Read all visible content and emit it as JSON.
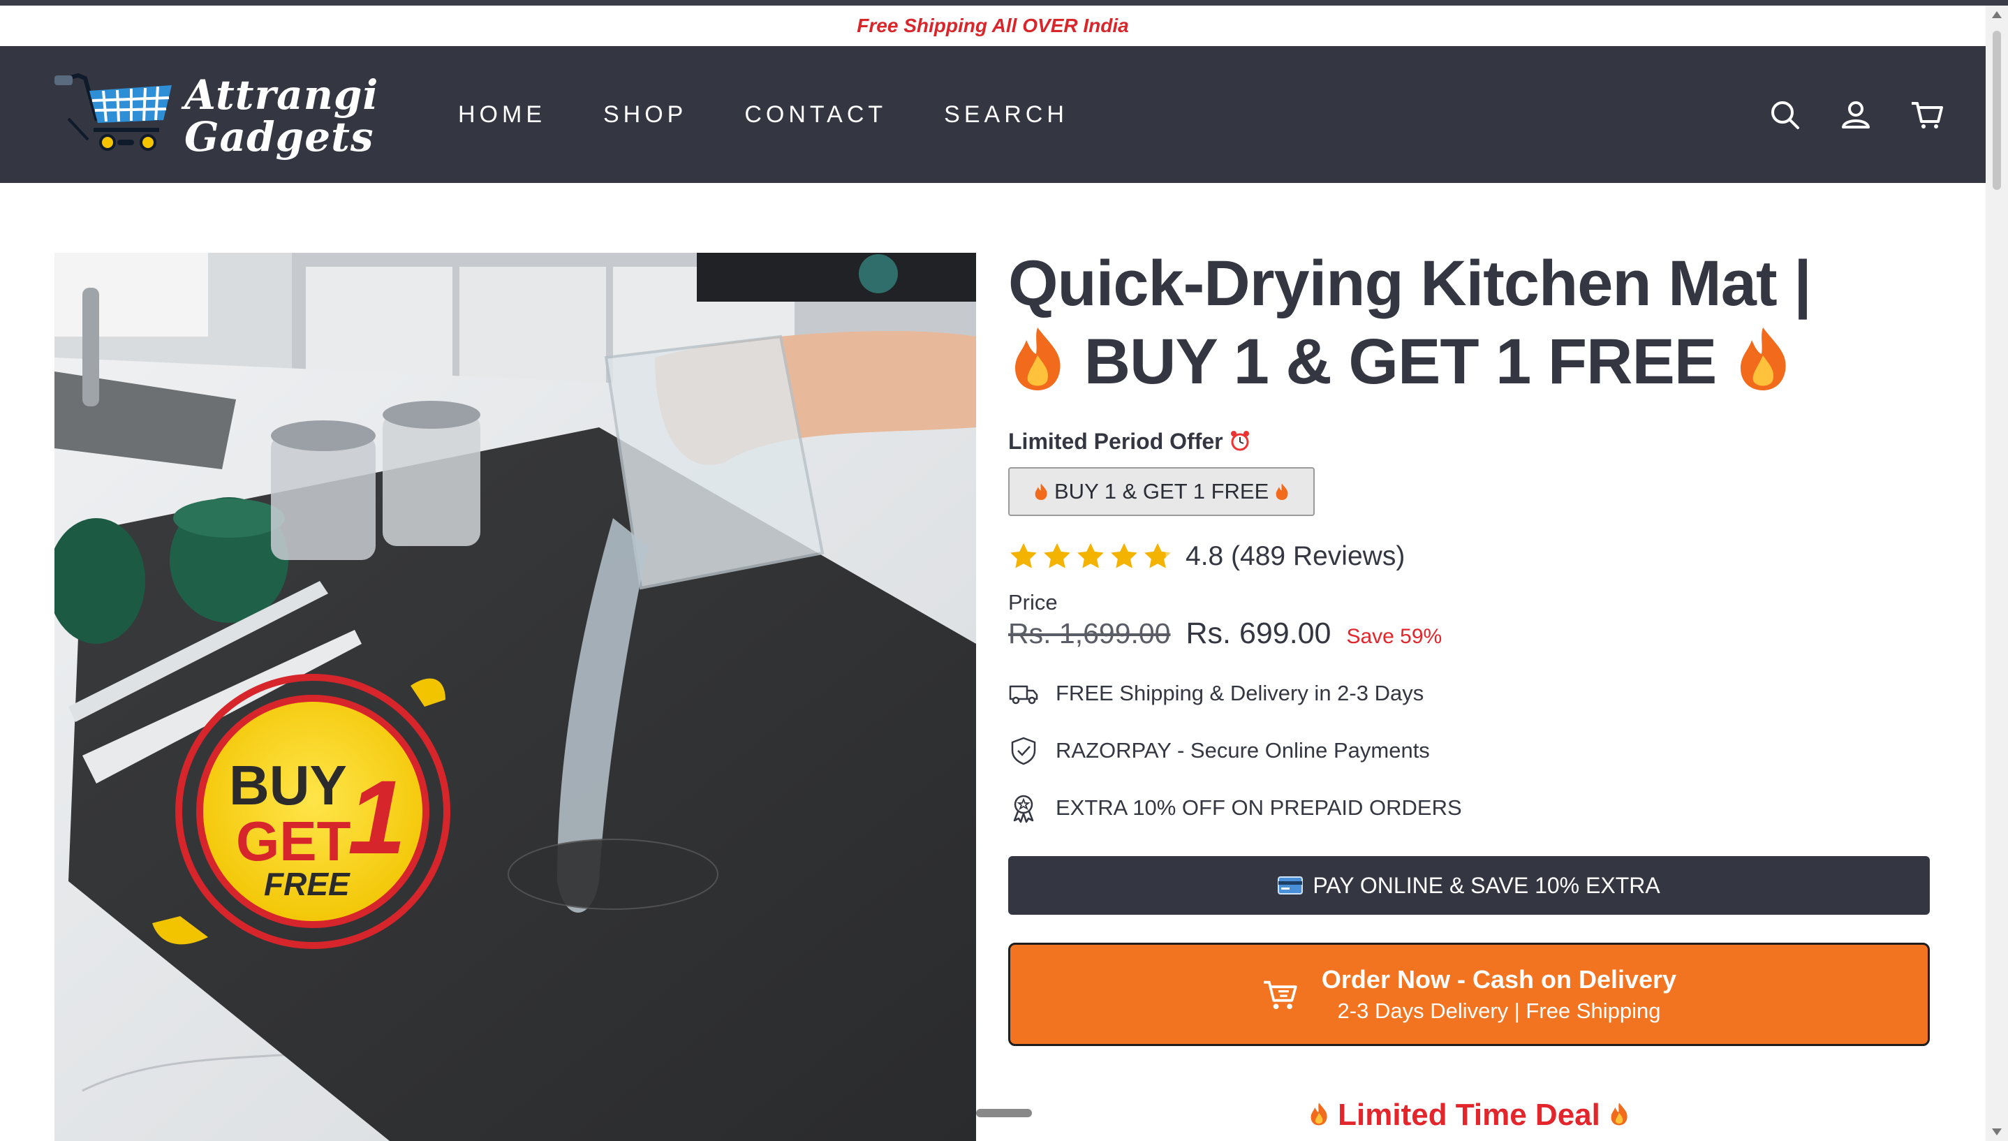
{
  "announcement": "Free Shipping All OVER India",
  "brand": {
    "line1": "Attrangi",
    "line2": "Gadgets"
  },
  "nav": [
    {
      "label": "HOME"
    },
    {
      "label": "SHOP"
    },
    {
      "label": "CONTACT"
    },
    {
      "label": "SEARCH"
    }
  ],
  "header_icons": [
    "search-icon",
    "account-icon",
    "cart-icon"
  ],
  "image": {
    "badge": {
      "line1": "BUY",
      "line2": "GET",
      "line3": "FREE",
      "number": "1"
    }
  },
  "product": {
    "title_line1": "Quick-Drying Kitchen Mat |",
    "title_line2": "BUY 1 & GET 1 FREE",
    "offer_label": "Limited Period Offer",
    "variant_label": "BUY 1 & GET 1 FREE",
    "rating_value": 4.8,
    "rating_text": "4.8 (489 Reviews)",
    "price_label": "Price",
    "compare_price": "Rs. 1,699.00",
    "price": "Rs. 699.00",
    "save_text": "Save 59%",
    "features": [
      {
        "icon": "truck-icon",
        "text": "FREE Shipping & Delivery in 2-3 Days"
      },
      {
        "icon": "shield-check-icon",
        "text": "RAZORPAY - Secure Online Payments"
      },
      {
        "icon": "award-icon",
        "text": "EXTRA 10% OFF ON PREPAID ORDERS"
      }
    ],
    "pay_online_label": "PAY ONLINE & SAVE 10% EXTRA",
    "cod_label": "Order Now - Cash on Delivery",
    "cod_sub": "2-3 Days Delivery | Free Shipping",
    "deal_label": "Limited Time Deal"
  },
  "colors": {
    "header": "#343642",
    "accent_orange": "#f27420",
    "sale_red": "#e2262b",
    "star": "#f5b301"
  }
}
